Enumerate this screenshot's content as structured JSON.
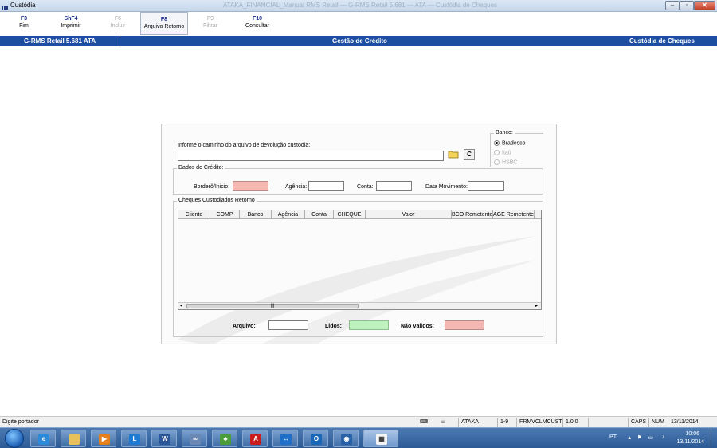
{
  "window": {
    "title": "Custódia",
    "faded_title": "ATAKA_FINANCIAL_Manual RMS Retail — G-RMS Retail 5.681 — ATA — Custódia de Cheques"
  },
  "fkeys": [
    {
      "key": "F3",
      "label": "Fim"
    },
    {
      "key": "ShF4",
      "label": "Imprimir"
    },
    {
      "key": "F6",
      "label": "Incluir"
    },
    {
      "key": "F8",
      "label": "Arquivo Retorno"
    },
    {
      "key": "F9",
      "label": "Filtrar"
    },
    {
      "key": "F10",
      "label": "Consultar"
    }
  ],
  "header": {
    "left": "G-RMS Retail 5.681 ATA",
    "center": "Gestão de Crédito",
    "right": "Custódia de Cheques"
  },
  "form": {
    "path_label": "Informe o caminho do arquivo de devolução custódia:",
    "path_value": "",
    "clear_button": "C",
    "bank": {
      "title": "Banco:",
      "options": [
        "Bradesco",
        "Itaú",
        "HSBC"
      ],
      "selected": "Bradesco"
    },
    "dados": {
      "title": "Dados do Crédito:",
      "bordero_label": "Borderô/Inicio:",
      "agencia_label": "Agência:",
      "conta_label": "Conta:",
      "data_label": "Data Movimento:"
    },
    "cheques": {
      "title": "Cheques Custodiados Retorno",
      "columns": [
        "Cliente",
        "COMP",
        "Banco",
        "Agência",
        "Conta",
        "CHEQUE",
        "Valor",
        "BCO Remetente",
        "AGE Remetente"
      ],
      "rows": []
    },
    "footer": {
      "arquivo_label": "Arquivo:",
      "lidos_label": "Lidos:",
      "invalidos_label": "Não Validos:"
    }
  },
  "status": {
    "left": "Digite portador",
    "user": "ATAKA",
    "range": "1-9",
    "form": "FRMVCLMCUST",
    "version": "1.0.0",
    "caps": "CAPS",
    "num": "NUM",
    "date": "13/11/2014"
  },
  "taskbar": {
    "lang": "PT",
    "time": "10:06",
    "date": "13/11/2014"
  }
}
